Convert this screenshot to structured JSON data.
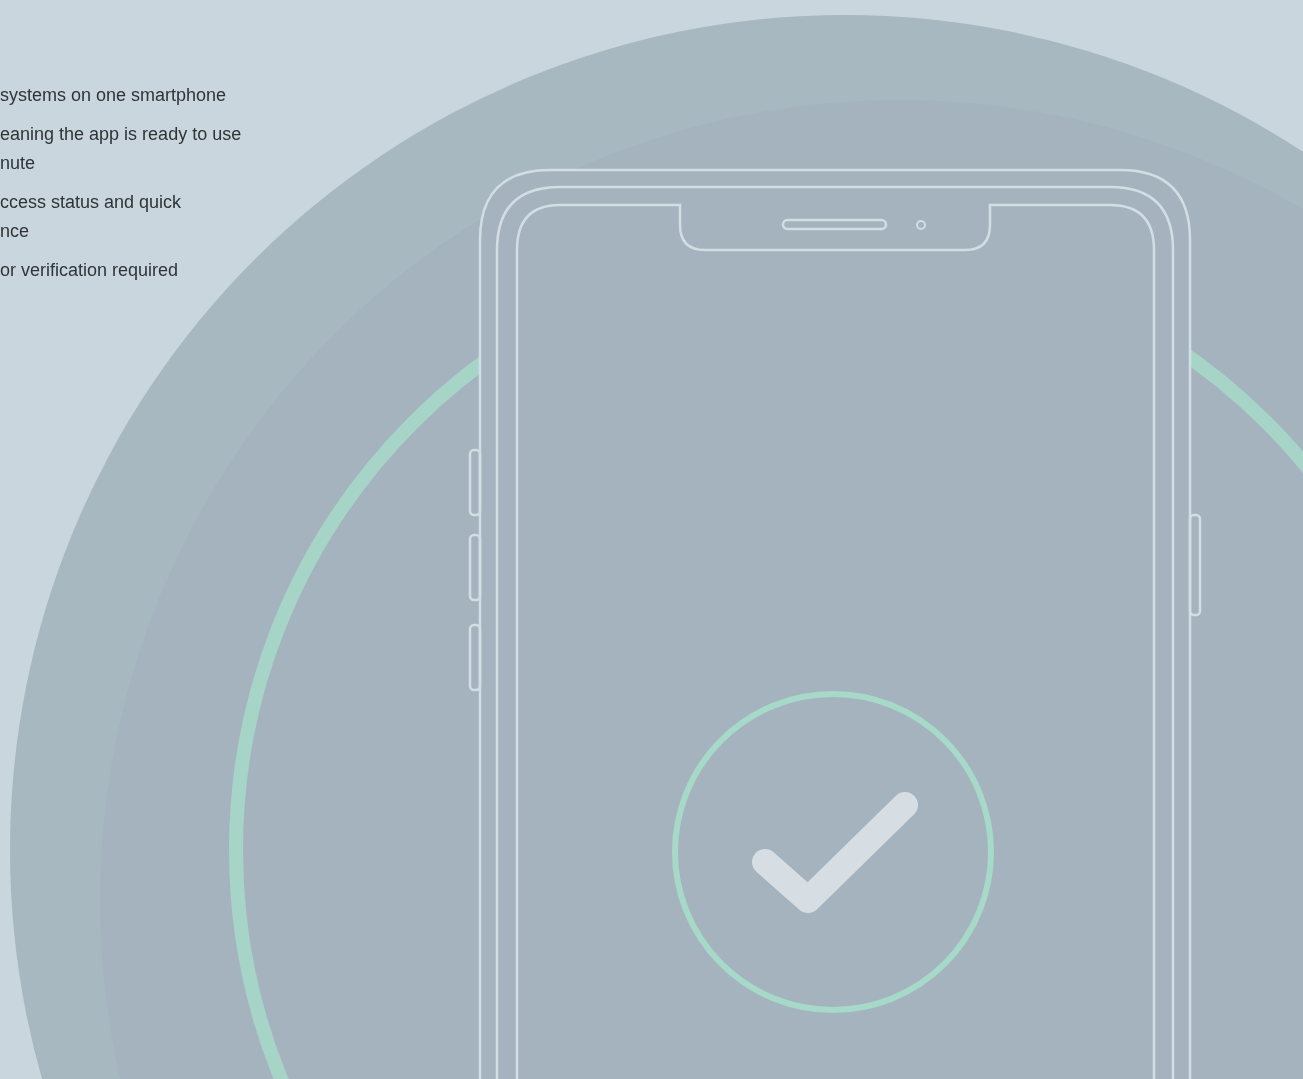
{
  "features": [
    {
      "lines": [
        "systems on one smartphone"
      ]
    },
    {
      "lines": [
        "eaning the app is ready to use",
        "nute"
      ]
    },
    {
      "lines": [
        "ccess status and quick",
        "nce"
      ]
    },
    {
      "lines": [
        "or verification required"
      ]
    }
  ]
}
